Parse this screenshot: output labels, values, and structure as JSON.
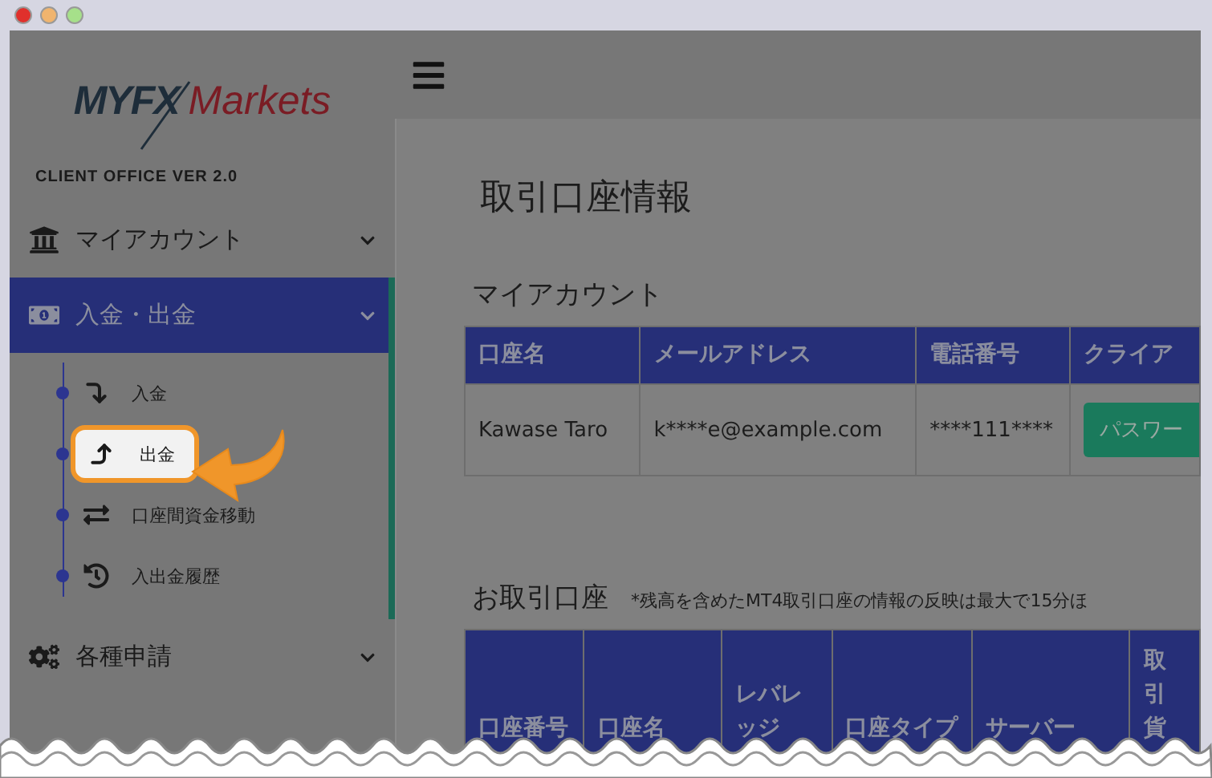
{
  "logo": {
    "brand": "MYFX",
    "suffix": "Markets"
  },
  "version": "CLIENT OFFICE VER 2.0",
  "menu": [
    {
      "label": "マイアカウント",
      "kind": "bank",
      "selected": false
    },
    {
      "label": "入金・出金",
      "kind": "cash",
      "selected": true,
      "children": [
        {
          "label": "入金",
          "kind": "deposit",
          "highlighted": false
        },
        {
          "label": "出金",
          "kind": "withdraw",
          "highlighted": true
        },
        {
          "label": "口座間資金移動",
          "kind": "transfer",
          "highlighted": false
        },
        {
          "label": "入出金履歴",
          "kind": "history",
          "highlighted": false
        }
      ]
    },
    {
      "label": "各種申請",
      "kind": "gears",
      "selected": false
    }
  ],
  "page_title": "取引口座情報",
  "my_account": {
    "heading": "マイアカウント",
    "columns": [
      "口座名",
      "メールアドレス",
      "電話番号",
      "クライア"
    ],
    "row": {
      "name": "Kawase Taro",
      "email": "k****e@example.com",
      "phone": "****111****",
      "button": "パスワー"
    }
  },
  "trading_accounts": {
    "heading": "お取引口座",
    "note": "*残高を含めたMT4取引口座の情報の反映は最大で15分ほ",
    "columns": [
      "口座番号",
      "口座名",
      "レバレッジ",
      "口座タイプ",
      "サーバー",
      "取引貨"
    ]
  }
}
